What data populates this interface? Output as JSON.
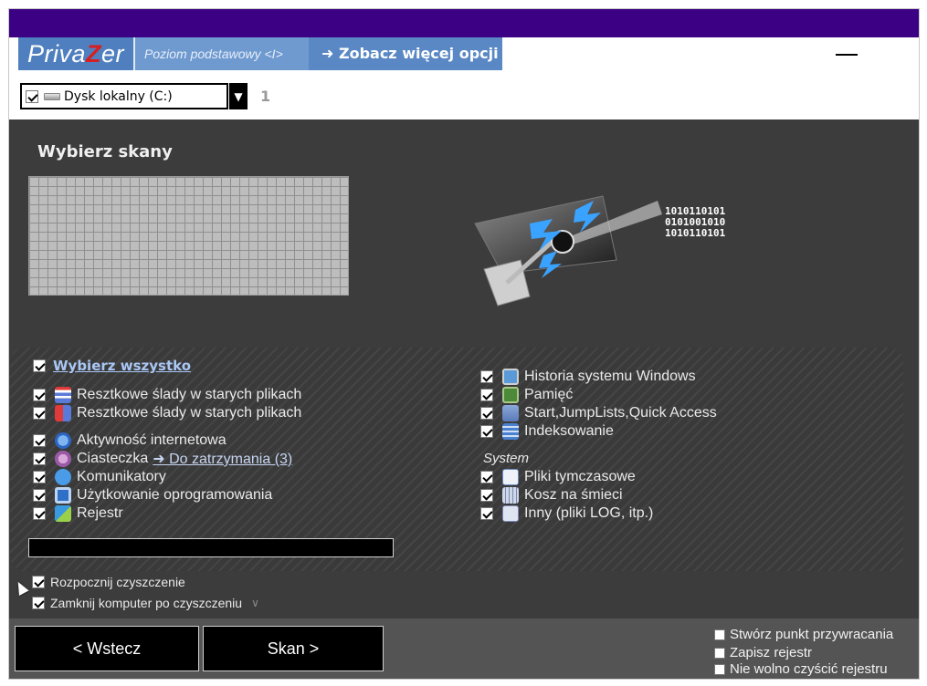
{
  "app": {
    "logo_pre": "Priva",
    "logo_z": "Z",
    "logo_post": "er",
    "level_label": "Poziom podstawowy <I>",
    "more_options_label": "➜ Zobacz więcej opcji",
    "minimize_icon": "minimize-icon"
  },
  "drive": {
    "label": "Dysk lokalny (C:)",
    "checked": true,
    "count": "1"
  },
  "scan": {
    "title": "Wybierz skany",
    "select_all": "Wybierz wszystko",
    "left_items": [
      {
        "label": "Resztkowe ślady w starych plikach",
        "icon": "file-list-icon"
      },
      {
        "label": "Resztkowe ślady w starych plikach",
        "icon": "file-grid-icon"
      },
      {
        "label": "Aktywność internetowa",
        "icon": "globe-icon"
      },
      {
        "label": "Ciasteczka",
        "icon": "cookie-icon",
        "link": "➜ Do zatrzymania (3)"
      },
      {
        "label": "Komunikatory",
        "icon": "chat-icon"
      },
      {
        "label": "Użytkowanie oprogramowania",
        "icon": "window-icon"
      },
      {
        "label": "Rejestr",
        "icon": "registry-icon"
      }
    ],
    "right_items": [
      {
        "label": "Historia systemu Windows",
        "icon": "monitor-icon"
      },
      {
        "label": "Pamięć",
        "icon": "memory-icon"
      },
      {
        "label": "Start,JumpLists,Quick Access",
        "icon": "start-menu-icon"
      },
      {
        "label": "Indeksowanie",
        "icon": "index-icon"
      }
    ],
    "system_label": "System",
    "system_items": [
      {
        "label": "Pliki tymczasowe",
        "icon": "temp-file-icon"
      },
      {
        "label": "Kosz na śmieci",
        "icon": "recycle-bin-icon"
      },
      {
        "label": "Inny (pliki LOG, itp.)",
        "icon": "log-file-icon"
      }
    ],
    "binary_lines": [
      "1010110101",
      "0101001010",
      "1010110101"
    ]
  },
  "options": {
    "start_cleaning": "Rozpocznij czyszczenie",
    "shutdown_after": "Zamknij komputer po czyszczeniu"
  },
  "buttons": {
    "back": "< Wstecz",
    "scan": "Skan >"
  },
  "right_options": {
    "restore_point": "Stwórz punkt przywracania",
    "save_registry": "Zapisz rejestr",
    "no_registry_clean": "Nie wolno czyścić rejestru"
  },
  "colors": {
    "titlebar": "#3b0084",
    "accent_blue": "#5a88c4",
    "panel_bg": "#3c3c3c"
  }
}
